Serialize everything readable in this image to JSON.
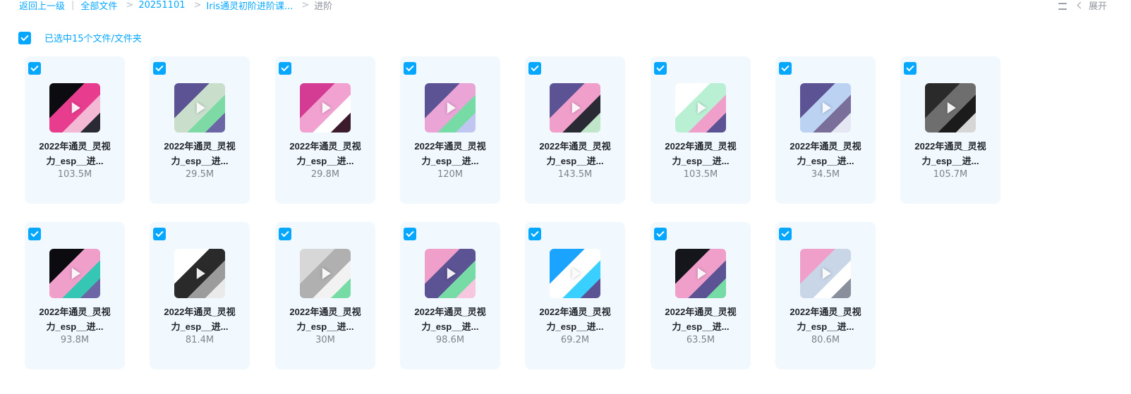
{
  "breadcrumb": {
    "back": "返回上一级",
    "items": [
      "全部文件",
      "20251101",
      "Iris通灵初阶进阶课...",
      "进阶"
    ]
  },
  "toolbar": {
    "expand_label": "展开",
    "list_view_icon": "list-view-icon"
  },
  "selection": {
    "label": "已选中15个文件/文件夹",
    "all_checked": true
  },
  "colors": {
    "accent": "#06a7ff",
    "card_bg": "#f1f9fe"
  },
  "files": [
    {
      "line1": "2022年通灵_灵视",
      "line2": "力_esp__进...",
      "size": "103.5M",
      "checked": true,
      "colors": [
        "#0c0c10",
        "#e83c8f",
        "#f4b9d4",
        "#2a2a34"
      ]
    },
    {
      "line1": "2022年通灵_灵视",
      "line2": "力_esp__进...",
      "size": "29.5M",
      "checked": true,
      "colors": [
        "#5b5393",
        "#c9dfcc",
        "#7ddaa4",
        "#6c66a6"
      ]
    },
    {
      "line1": "2022年通灵_灵视",
      "line2": "力_esp__进...",
      "size": "29.8M",
      "checked": true,
      "colors": [
        "#d43b93",
        "#f1a2d0",
        "#ffffff",
        "#3b1b2c"
      ]
    },
    {
      "line1": "2022年通灵_灵视",
      "line2": "力_esp__进...",
      "size": "120M",
      "checked": true,
      "colors": [
        "#5b5393",
        "#eaa4d6",
        "#77dba5",
        "#bfc7f0"
      ]
    },
    {
      "line1": "2022年通灵_灵视",
      "line2": "力_esp__进...",
      "size": "143.5M",
      "checked": true,
      "colors": [
        "#5b5393",
        "#ef9fca",
        "#2a2a34",
        "#bfe6c8"
      ]
    },
    {
      "line1": "2022年通灵_灵视",
      "line2": "力_esp__进...",
      "size": "103.5M",
      "checked": true,
      "colors": [
        "#ffffff",
        "#b9f0d4",
        "#ef9fca",
        "#5b5393"
      ]
    },
    {
      "line1": "2022年通灵_灵视",
      "line2": "力_esp__进...",
      "size": "34.5M",
      "checked": true,
      "colors": [
        "#5b5393",
        "#bcd2f3",
        "#7a6f9a",
        "#e5e8f2"
      ]
    },
    {
      "line1": "2022年通灵_灵视",
      "line2": "力_esp__进...",
      "size": "105.7M",
      "checked": true,
      "colors": [
        "#2a2a2a",
        "#6e6e6e",
        "#1b1b1b",
        "#d6d6d6"
      ]
    },
    {
      "line1": "2022年通灵_灵视",
      "line2": "力_esp__进...",
      "size": "93.8M",
      "checked": true,
      "colors": [
        "#0c0c10",
        "#ef9fca",
        "#35c7b3",
        "#6c66a6"
      ]
    },
    {
      "line1": "2022年通灵_灵视",
      "line2": "力_esp__进...",
      "size": "81.4M",
      "checked": true,
      "colors": [
        "#ffffff",
        "#2a2a2a",
        "#9c9c9c",
        "#eaeaea"
      ]
    },
    {
      "line1": "2022年通灵_灵视",
      "line2": "力_esp__进...",
      "size": "30M",
      "checked": true,
      "colors": [
        "#d7d7d7",
        "#b0b0b0",
        "#f2f2f2",
        "#77dba5"
      ]
    },
    {
      "line1": "2022年通灵_灵视",
      "line2": "力_esp__进...",
      "size": "98.6M",
      "checked": true,
      "colors": [
        "#ef9fca",
        "#5b5393",
        "#77dba5",
        "#f7c6df"
      ]
    },
    {
      "line1": "2022年通灵_灵视",
      "line2": "力_esp__进...",
      "size": "69.2M",
      "checked": true,
      "colors": [
        "#1aa3ff",
        "#ffffff",
        "#39d0ff",
        "#5b5393"
      ]
    },
    {
      "line1": "2022年通灵_灵视",
      "line2": "力_esp__进...",
      "size": "63.5M",
      "checked": true,
      "colors": [
        "#15151c",
        "#ef9fca",
        "#5b5393",
        "#77dba5"
      ]
    },
    {
      "line1": "2022年通灵_灵视",
      "line2": "力_esp__进...",
      "size": "80.6M",
      "checked": true,
      "colors": [
        "#ef9fca",
        "#c9d6e8",
        "#ffffff",
        "#8a8f9c"
      ]
    }
  ]
}
